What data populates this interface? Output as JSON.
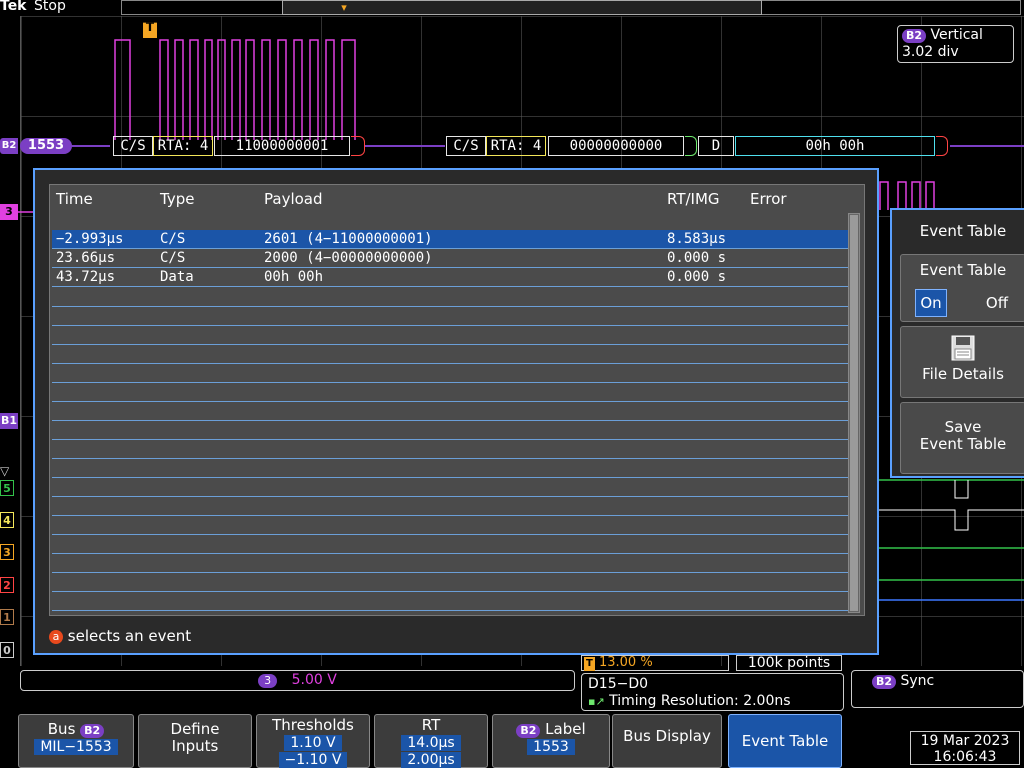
{
  "header": {
    "brand": "Tek",
    "status": "Stop"
  },
  "trigger_marker": "T",
  "vertical_readout": {
    "badge": "B2",
    "title": "Vertical",
    "value": "3.02 div"
  },
  "bus_label": {
    "badge": "B2",
    "name": "1553"
  },
  "channel_markers": {
    "ch3": "3",
    "b1": "B1",
    "d5": "5",
    "d4": "4",
    "d3": "3",
    "d2": "2",
    "d1": "1",
    "d0": "0"
  },
  "decode": {
    "cs1": "C/S",
    "rta1": "RTA: 4",
    "val1": "11000000001",
    "cs2": "C/S",
    "rta2": "RTA: 4",
    "val2": "00000000000",
    "d": "D",
    "data": "00h 00h"
  },
  "event_table": {
    "headers": [
      "Time",
      "Type",
      "Payload",
      "RT/IMG",
      "Error"
    ],
    "rows": [
      {
        "time": "−2.993µs",
        "type": "C/S",
        "payload": "2601 (4−11000000001)",
        "rt": "8.583µs",
        "error": ""
      },
      {
        "time": "23.66µs",
        "type": "C/S",
        "payload": "2000 (4−00000000000)",
        "rt": "0.000 s",
        "error": ""
      },
      {
        "time": "43.72µs",
        "type": "Data",
        "payload": "00h 00h",
        "rt": "0.000 s",
        "error": ""
      }
    ],
    "selected_row": 0,
    "hint_icon": "a",
    "hint": "selects an event"
  },
  "side_menu": {
    "title": "Event Table",
    "toggle_label": "Event Table",
    "on": "On",
    "off": "Off",
    "file_details": "File Details",
    "save_line1": "Save",
    "save_line2": "Event Table"
  },
  "readouts": {
    "trigger_pos": "13.00 %",
    "points": "100k points",
    "ch3_badge": "3",
    "ch3_scale": "5.00 V",
    "digital_range": "D15−D0",
    "timing": "Timing Resolution: 2.00ns",
    "sync_badge": "B2",
    "sync": "Sync"
  },
  "bottom_menu": {
    "bus": {
      "label": "Bus",
      "badge": "B2",
      "value": "MIL−1553"
    },
    "define_inputs": {
      "line1": "Define",
      "line2": "Inputs"
    },
    "thresholds": {
      "label": "Thresholds",
      "v1": "1.10 V",
      "v2": "−1.10 V"
    },
    "rt": {
      "label": "RT",
      "v1": "14.0µs",
      "v2": "2.00µs"
    },
    "label": {
      "badge": "B2",
      "label": "Label",
      "value": "1553"
    },
    "bus_display": "Bus Display",
    "event_table": "Event Table"
  },
  "datetime": {
    "date": "19 Mar 2023",
    "time": "16:06:43"
  },
  "colors": {
    "accent": "#1b55a8",
    "border": "#5aa0ff",
    "magenta": "#e040e0",
    "bus_badge": "#7b3fc4"
  }
}
